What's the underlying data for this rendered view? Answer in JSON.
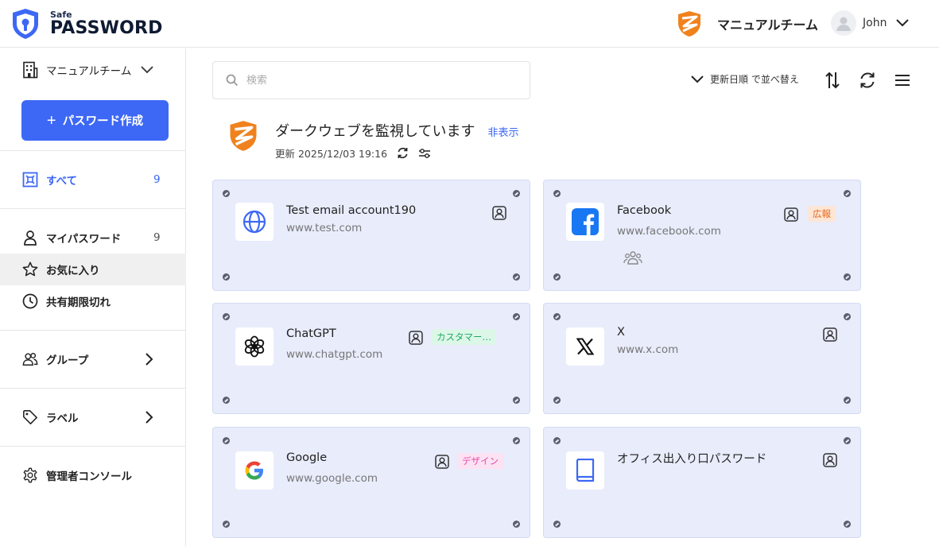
{
  "header": {
    "logo_small": "Safe",
    "logo_big": "PASSWORD",
    "team_name": "マニュアルチーム",
    "user_name": "John"
  },
  "sidebar": {
    "team_select": "マニュアルチーム",
    "create_button": "パスワード作成",
    "items": {
      "all": {
        "label": "すべて",
        "count": "9"
      },
      "my": {
        "label": "マイパスワード",
        "count": "9"
      },
      "favorites": {
        "label": "お気に入り"
      },
      "expired": {
        "label": "共有期限切れ"
      },
      "groups": {
        "label": "グループ"
      },
      "labels": {
        "label": "ラベル"
      },
      "admin": {
        "label": "管理者コンソール"
      }
    }
  },
  "toolbar": {
    "search_placeholder": "検索",
    "sort_label": "更新日順 で並べ替え"
  },
  "darkweb": {
    "title": "ダークウェブを監視しています",
    "hide_link": "非表示",
    "updated": "更新 2025/12/03 19:16"
  },
  "cards": [
    {
      "name": "Test email account190",
      "url": "www.test.com",
      "icon": "globe-icon"
    },
    {
      "name": "Facebook",
      "url": "www.facebook.com",
      "icon": "facebook-icon",
      "tag": "広報",
      "tag_color": "#e66a1f"
    },
    {
      "name": "ChatGPT",
      "url": "www.chatgpt.com",
      "icon": "chatgpt-icon",
      "tag": "カスタマー…",
      "tag_color": "#1eaa62"
    },
    {
      "name": "X",
      "url": "www.x.com",
      "icon": "x-icon"
    },
    {
      "name": "Google",
      "url": "www.google.com",
      "icon": "google-icon",
      "tag": "デザイン",
      "tag_color": "#e04aa8"
    },
    {
      "name": "オフィス出入り口パスワード",
      "url": "",
      "icon": "book-icon"
    }
  ],
  "colors": {
    "accent": "#3d68f5",
    "card_bg": "#e8ecfb",
    "brand_orange": "#f0821e"
  }
}
